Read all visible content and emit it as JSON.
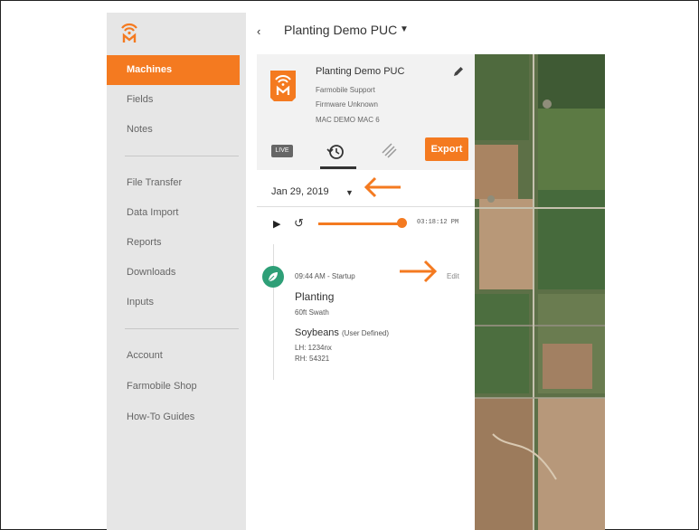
{
  "header": {
    "back_icon": "chevron-left-icon",
    "title": "Planting Demo PUC",
    "dropdown_icon": "caret-down-icon"
  },
  "sidebar": {
    "logo": "farmobile-logo",
    "items": [
      {
        "label": "Machines",
        "active": true
      },
      {
        "label": "Fields"
      },
      {
        "label": "Notes"
      },
      {
        "label": "File Transfer"
      },
      {
        "label": "Data Import"
      },
      {
        "label": "Reports"
      },
      {
        "label": "Downloads"
      },
      {
        "label": "Inputs"
      },
      {
        "label": "Account"
      },
      {
        "label": "Farmobile Shop"
      },
      {
        "label": "How-To Guides"
      }
    ]
  },
  "machine": {
    "name": "Planting Demo PUC",
    "owner": "Farmobile Support",
    "firmware": "Firmware Unknown",
    "mac": "MAC DEMO MAC 6",
    "edit_icon": "pencil-icon"
  },
  "tabs": {
    "live": "LIVE",
    "history_icon": "history-icon",
    "hatch_icon": "hatch-icon",
    "export": "Export"
  },
  "date": {
    "value": "Jan 29, 2019",
    "dropdown_icon": "caret-down-icon"
  },
  "playback": {
    "time": "03:18:12 PM",
    "progress": 0.92
  },
  "event": {
    "time": "09:44 AM - Startup",
    "edit": "Edit",
    "title": "Planting",
    "swath": "60ft Swath",
    "crop": "Soybeans",
    "crop_note": "(User Defined)",
    "lh": "LH: 1234nx",
    "rh": "RH: 54321"
  },
  "colors": {
    "accent": "#f47a20",
    "leaf": "#2e9f77",
    "sidebar": "#e6e6e6"
  }
}
